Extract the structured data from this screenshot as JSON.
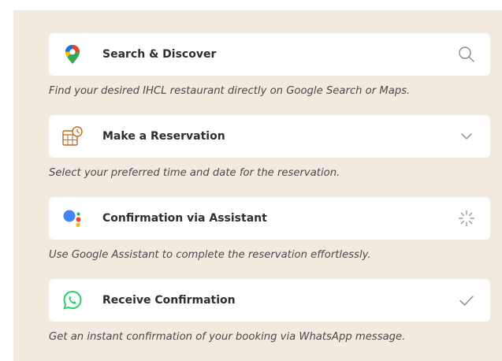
{
  "steps": [
    {
      "title": "Search & Discover",
      "description": "Find your desired IHCL restaurant directly on Google Search or Maps.",
      "icon": "maps-pin-icon",
      "action_icon": "search-icon"
    },
    {
      "title": "Make a Reservation",
      "description": "Select your preferred time and date for the reservation.",
      "icon": "calendar-clock-icon",
      "action_icon": "chevron-down-icon"
    },
    {
      "title": "Confirmation via Assistant",
      "description": "Use Google Assistant to complete the reservation effortlessly.",
      "icon": "google-assistant-icon",
      "action_icon": "loading-spinner-icon"
    },
    {
      "title": "Receive Confirmation",
      "description": "Get an instant confirmation of your booking via WhatsApp message.",
      "icon": "whatsapp-icon",
      "action_icon": "checkmark-icon"
    }
  ],
  "colors": {
    "panel_background": "#f2eadf",
    "card_background": "#ffffff",
    "title_text": "#2e2e2e",
    "description_text": "#4a4a4a",
    "icon_gray": "#8a8a8a",
    "whatsapp_green": "#25d366",
    "calendar_orange": "#c2691f"
  }
}
